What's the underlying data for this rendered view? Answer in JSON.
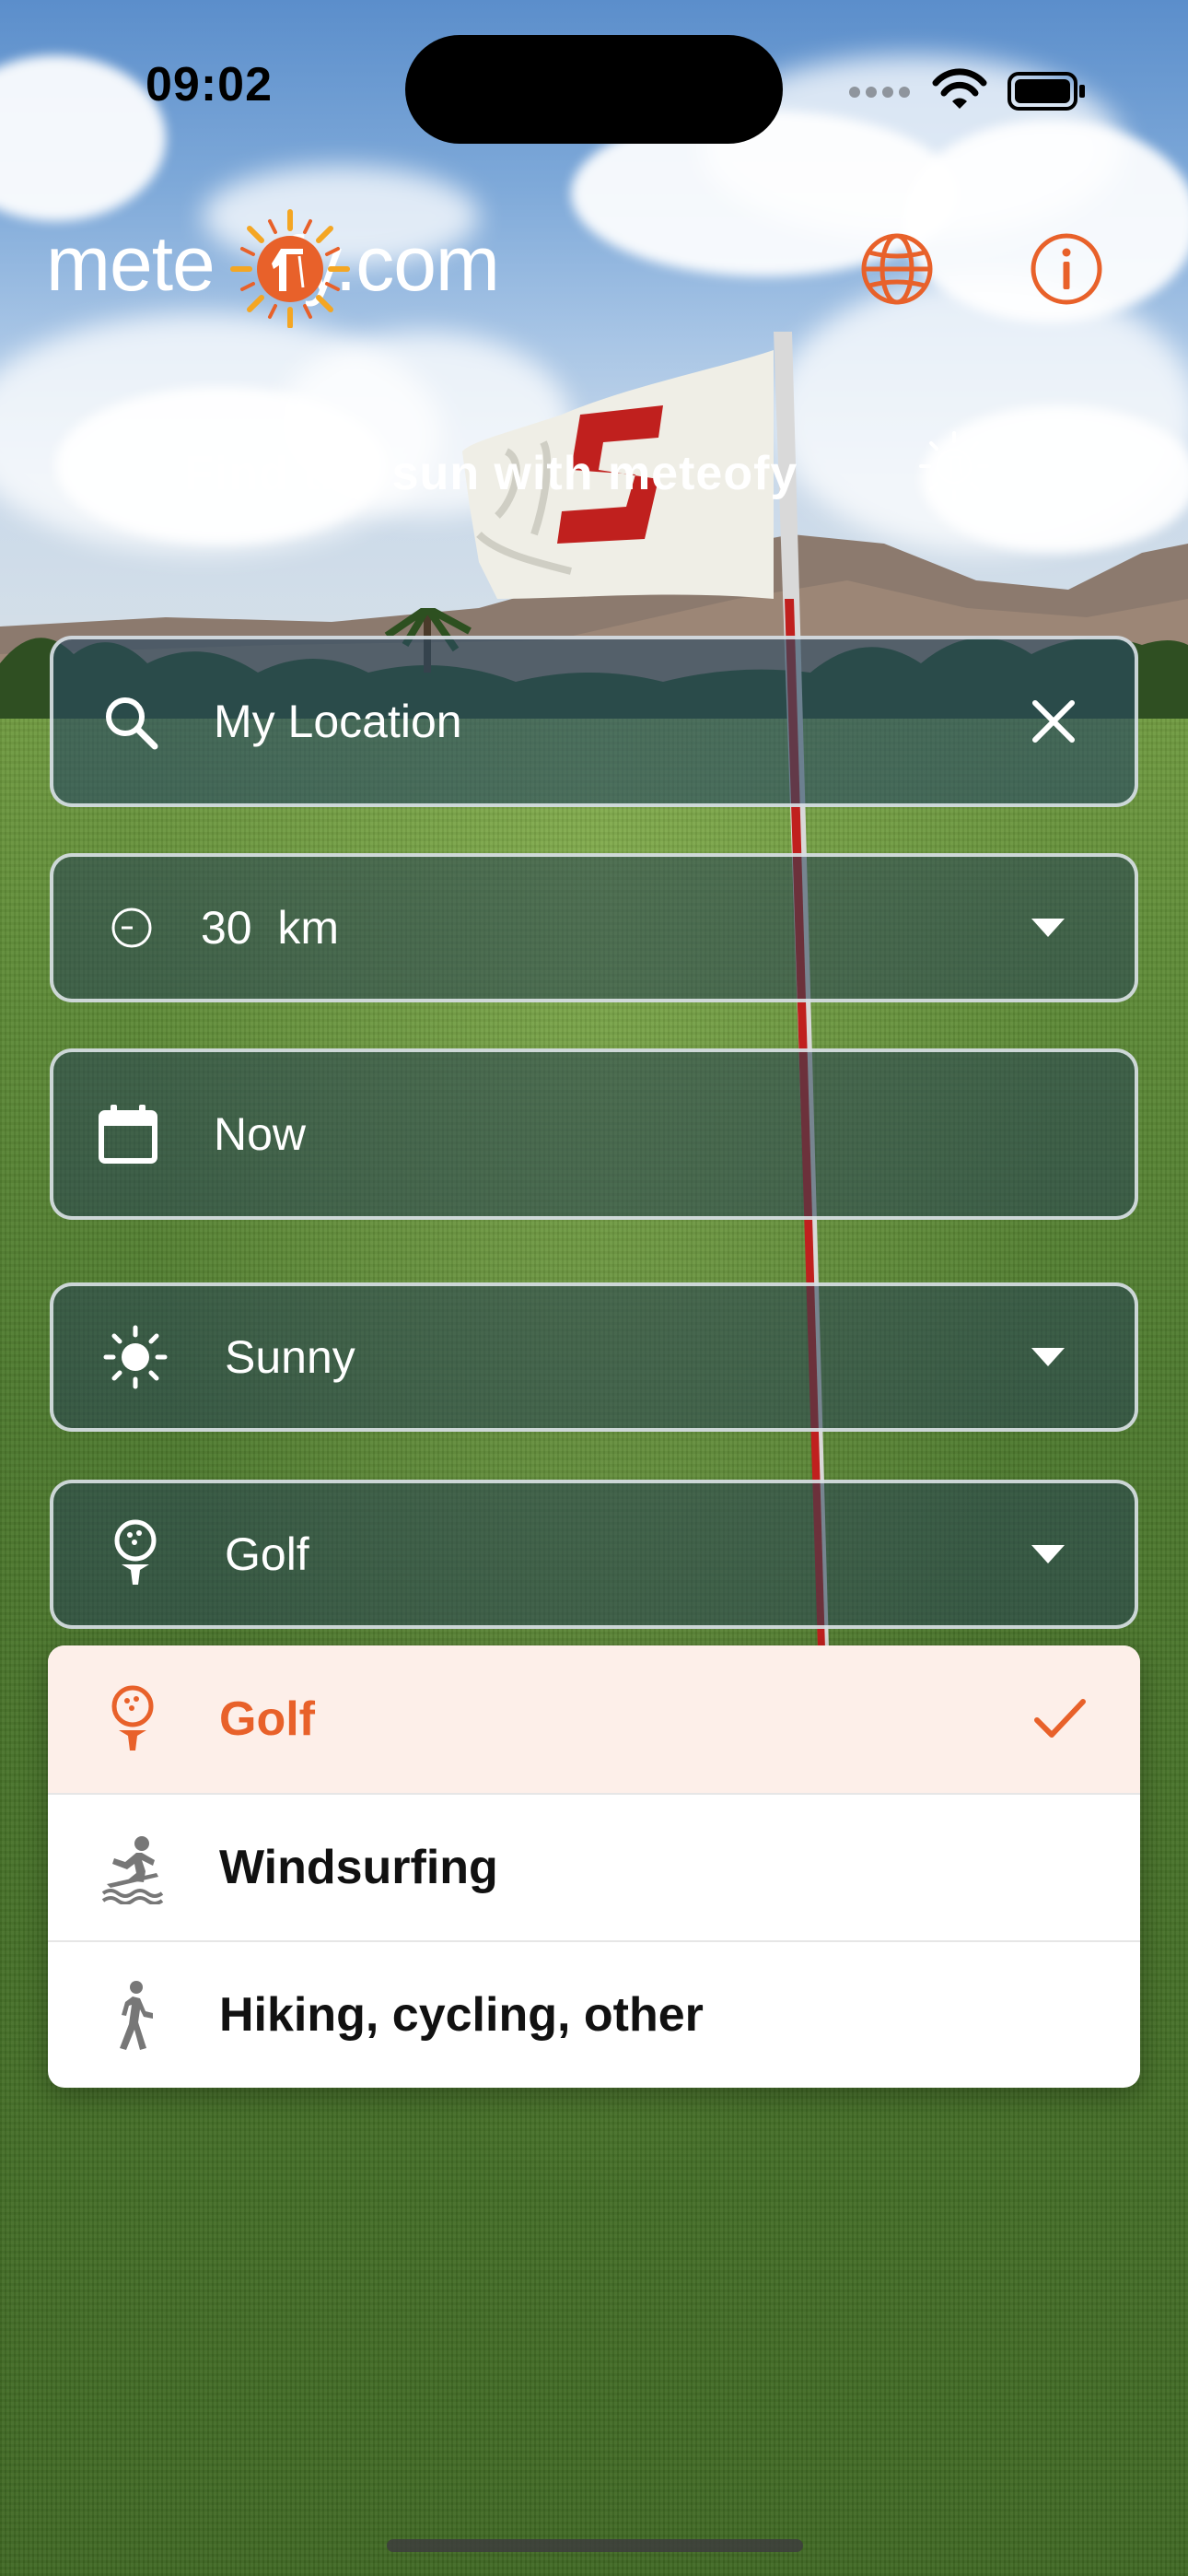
{
  "status_bar": {
    "time": "09:02",
    "icons": [
      "cellular-dots-icon",
      "wifi-icon",
      "battery-icon"
    ]
  },
  "header": {
    "logo_text_left": "mete",
    "logo_text_right": "fy.com",
    "logo_sun_icon": "sun-golfer-icon",
    "globe_icon": "globe-icon",
    "info_icon": "info-icon"
  },
  "tagline": {
    "text": "Find the sun with meteofy",
    "icon": "sun-golfer-icon"
  },
  "form": {
    "location": {
      "value": "My Location",
      "icon": "search-icon",
      "clear_icon": "close-icon"
    },
    "radius": {
      "value": "30",
      "unit": "km",
      "icon": "radius-icon"
    },
    "date": {
      "value": "Now",
      "icon": "calendar-icon"
    },
    "weather": {
      "value": "Sunny",
      "icon": "sun-icon"
    },
    "activity": {
      "value": "Golf",
      "icon": "golf-tee-icon"
    }
  },
  "activity_menu": {
    "items": [
      {
        "label": "Golf",
        "icon": "golf-tee-icon",
        "selected": true
      },
      {
        "label": "Windsurfing",
        "icon": "surfer-icon",
        "selected": false
      },
      {
        "label": "Hiking, cycling, other",
        "icon": "walker-icon",
        "selected": false
      }
    ]
  },
  "colors": {
    "accent": "#e8612a",
    "selected_bg": "#fdefe9",
    "field_bg": "#264054",
    "field_border": "#e6ecf0"
  }
}
